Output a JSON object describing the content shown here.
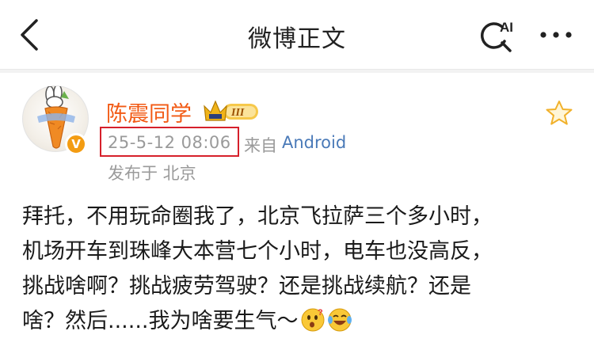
{
  "nav": {
    "title": "微博正文",
    "ai_label": "AI"
  },
  "author": {
    "name": "陈震同学",
    "level_badge": "III",
    "verified_mark": "V"
  },
  "meta": {
    "timestamp": "25-5-12 08:06",
    "from_label": "来自",
    "source": "Android",
    "location": "发布于 北京"
  },
  "post": {
    "lines": [
      "拜托，不用玩命圈我了，北京飞拉萨三个多小时，",
      "机场开车到珠峰大本营七个小时，电车也没高反，",
      "挑战啥啊？挑战疲劳驾驶？还是挑战续航？还是",
      "啥？然后......我为啥要生气～"
    ],
    "emojis": [
      "thinking-face-emoji",
      "crying-laughing-emoji"
    ]
  },
  "colors": {
    "username": "#f25a14",
    "source_link": "#4a7ab8",
    "highlight_box": "#d6202b",
    "meta_text": "#9a9a9a"
  }
}
